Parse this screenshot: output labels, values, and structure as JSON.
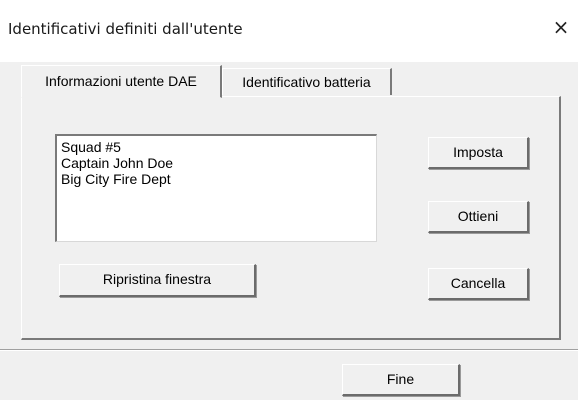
{
  "window": {
    "title": "Identificativi definiti dall'utente",
    "close_glyph": "×"
  },
  "tabs": [
    {
      "label": "Informazioni utente DAE",
      "active": true
    },
    {
      "label": "Identificativo batteria",
      "active": false
    }
  ],
  "user_info": {
    "lines": [
      "Squad #5",
      "Captain John Doe",
      "Big City Fire Dept"
    ]
  },
  "buttons": {
    "imposta": "Imposta",
    "ottieni": "Ottieni",
    "cancella": "Cancella",
    "ripristina": "Ripristina finestra",
    "fine": "Fine"
  },
  "colors": {
    "dialog_bg": "#f0f0f0",
    "titlebar_bg": "#ffffff",
    "listbox_bg": "#ffffff"
  }
}
